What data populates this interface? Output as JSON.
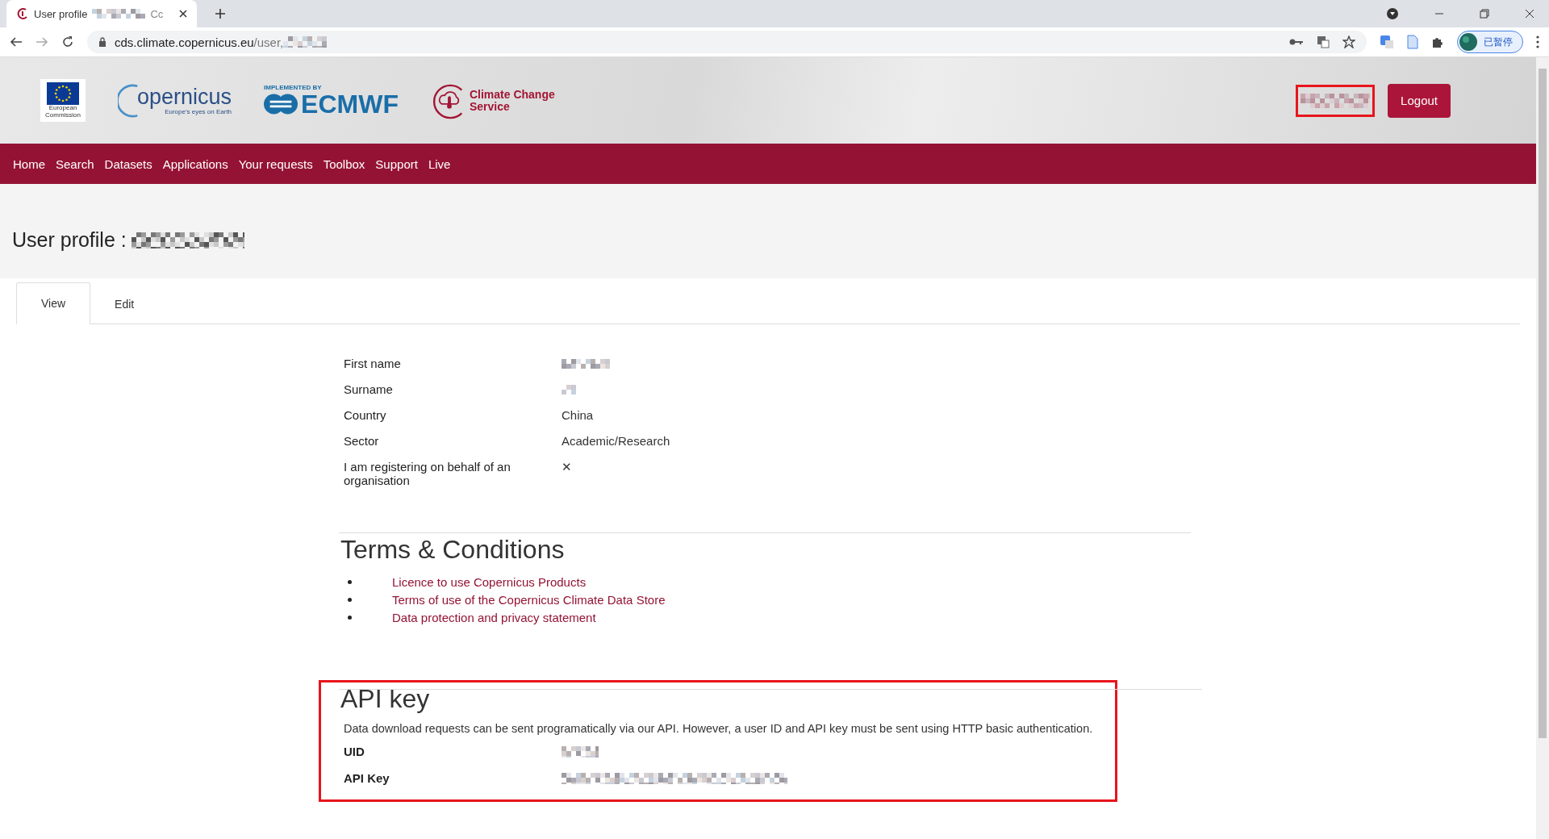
{
  "browser": {
    "tab_title": "User profile",
    "tab_title_tail": "Cc",
    "url_host": "cds.climate.copernicus.eu",
    "url_path": "/user,",
    "profile_label": "已暂停"
  },
  "header": {
    "eu_caption": "European Commission",
    "copernicus_name": "opernicus",
    "copernicus_tagline": "Europe's eyes on Earth",
    "ecmwf_caption": "IMPLEMENTED BY",
    "ecmwf_name": "ECMWF",
    "c3s_name": "Climate Change Service",
    "logout": "Logout"
  },
  "nav": [
    "Home",
    "Search",
    "Datasets",
    "Applications",
    "Your requests",
    "Toolbox",
    "Support",
    "Live"
  ],
  "page_title": "User profile :",
  "tabs": [
    {
      "label": "View",
      "selected": true
    },
    {
      "label": "Edit",
      "selected": false
    }
  ],
  "fields": [
    {
      "label": "First name",
      "kind": "redacted"
    },
    {
      "label": "Surname",
      "kind": "redacted"
    },
    {
      "label": "Country",
      "kind": "text",
      "value": "China"
    },
    {
      "label": "Sector",
      "kind": "text",
      "value": "Academic/Research"
    },
    {
      "label": "I am registering on behalf of an organisation",
      "kind": "text",
      "value": "✕"
    }
  ],
  "terms": {
    "heading": "Terms & Conditions",
    "links": [
      "Licence to use Copernicus Products",
      "Terms of use of the Copernicus Climate Data Store",
      "Data protection and privacy statement"
    ]
  },
  "api": {
    "heading": "API key",
    "description": "Data download requests can be sent programatically via our API. However, a user ID and API key must be sent using HTTP basic authentication.",
    "fields": [
      {
        "label": "UID",
        "kind": "redacted"
      },
      {
        "label": "API Key",
        "kind": "redacted"
      }
    ]
  }
}
